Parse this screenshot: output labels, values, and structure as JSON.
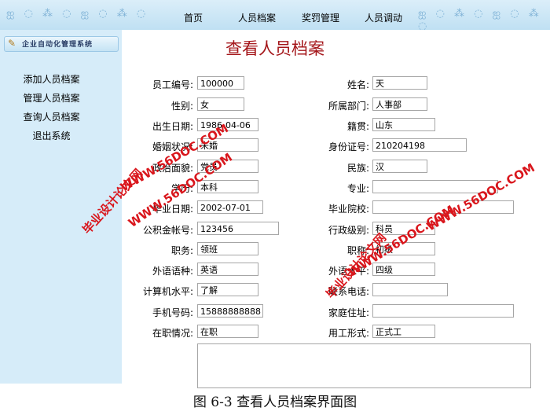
{
  "nav": {
    "items": [
      "首页",
      "人员档案",
      "奖罚管理",
      "人员调动"
    ],
    "decor_left": "ஐ ◌ ⁂ ◌ ஐ ◌ ⁂ ◌",
    "decor_right": "ஐ ◌ ⁂ ◌ ஐ ◌ ⁂ ◌"
  },
  "sidebar": {
    "header": "企业自动化管理系统",
    "items": [
      "添加人员档案",
      "管理人员档案",
      "查询人员档案",
      "退出系统"
    ]
  },
  "page": {
    "title": "查看人员档案"
  },
  "form": {
    "left": [
      {
        "label": "员工编号:",
        "value": "100000"
      },
      {
        "label": "性别:",
        "value": "女"
      },
      {
        "label": "出生日期:",
        "value": "1986-04-06"
      },
      {
        "label": "婚姻状况:",
        "value": "未婚"
      },
      {
        "label": "政治面貌:",
        "value": "党员"
      },
      {
        "label": "学历:",
        "value": "本科"
      },
      {
        "label": "毕业日期:",
        "value": "2002-07-01"
      },
      {
        "label": "公积金帐号:",
        "value": "123456"
      },
      {
        "label": "职务:",
        "value": "领班"
      },
      {
        "label": "外语语种:",
        "value": "英语"
      },
      {
        "label": "计算机水平:",
        "value": "了解"
      },
      {
        "label": "手机号码:",
        "value": "15888888888"
      },
      {
        "label": "在职情况:",
        "value": "在职"
      }
    ],
    "right": [
      {
        "label": "姓名:",
        "value": "天"
      },
      {
        "label": "所属部门:",
        "value": "人事部"
      },
      {
        "label": "籍贯:",
        "value": "山东"
      },
      {
        "label": "身份证号:",
        "value": "210204198"
      },
      {
        "label": "民族:",
        "value": "汉"
      },
      {
        "label": "专业:",
        "value": ""
      },
      {
        "label": "毕业院校:",
        "value": ""
      },
      {
        "label": "行政级别:",
        "value": "科员"
      },
      {
        "label": "职称:",
        "value": "初级"
      },
      {
        "label": "外语水平:",
        "value": "四级"
      },
      {
        "label": "联系电话:",
        "value": ""
      },
      {
        "label": "家庭住址:",
        "value": ""
      },
      {
        "label": "用工形式:",
        "value": "正式工"
      }
    ],
    "remarks": ""
  },
  "watermarks": {
    "top": "WWW.56DOC.COM",
    "left_name": "毕业设计论文网",
    "left_url": "WWW.56DOC.COM",
    "right_name": "毕业设计论文网",
    "right_url": "WWW.56DOC.COM",
    "far_right": "WWW.56DOC.COM"
  },
  "caption": "图 6-3  查看人员档案界面图"
}
